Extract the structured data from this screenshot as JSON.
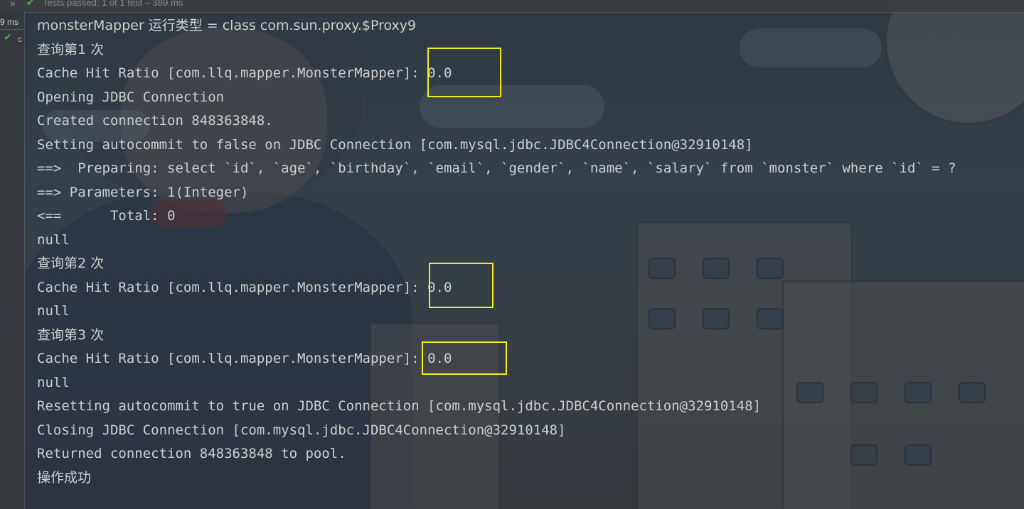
{
  "top_bar": {
    "status_text": "Tests passed: 1 of 1 test – 389 ms",
    "chevron_icon": "double-chevron-right-icon",
    "check_icon": "check-icon"
  },
  "left_gutter": {
    "time_label": "9 ms",
    "item_label": "c",
    "check_icon": "check-icon"
  },
  "console": {
    "lines": [
      "monsterMapper 运行类型 = class com.sun.proxy.$Proxy9",
      "查询第1 次",
      "Cache Hit Ratio [com.llq.mapper.MonsterMapper]: 0.0",
      "Opening JDBC Connection",
      "Created connection 848363848.",
      "Setting autocommit to false on JDBC Connection [com.mysql.jdbc.JDBC4Connection@32910148]",
      "==>  Preparing: select `id`, `age`, `birthday`, `email`, `gender`, `name`, `salary` from `monster` where `id` = ?",
      "==> Parameters: 1(Integer)",
      "<==      Total: 0",
      "null",
      "查询第2 次",
      "Cache Hit Ratio [com.llq.mapper.MonsterMapper]: 0.0",
      "null",
      "查询第3 次",
      "Cache Hit Ratio [com.llq.mapper.MonsterMapper]: 0.0",
      "null",
      "Resetting autocommit to true on JDBC Connection [com.mysql.jdbc.JDBC4Connection@32910148]",
      "Closing JDBC Connection [com.mysql.jdbc.JDBC4Connection@32910148]",
      "Returned connection 848363848 to pool.",
      "操作成功"
    ]
  },
  "annotation_color": "#f2ee1c"
}
